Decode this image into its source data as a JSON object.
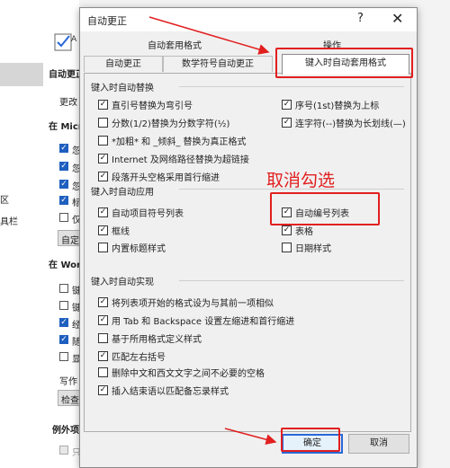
{
  "background": {
    "labels": {
      "auto_correct": "自动更正",
      "change": "更改",
      "in_ms": "在 Micr",
      "qu": "区",
      "tools": "具栏",
      "custom": "自定",
      "in_word": "在 Wor",
      "write": "写作",
      "check": "检查",
      "exceptions": "例外项",
      "item": "只"
    },
    "checkbox_labels": [
      "忽",
      "忽",
      "忽",
      "标",
      "仅",
      "键",
      "键",
      "经",
      "随",
      "显"
    ]
  },
  "dialog": {
    "title": "自动更正",
    "help_label": "?",
    "close_label": "✕",
    "tabs_row1": [
      "自动套用格式",
      "操作"
    ],
    "tabs_row2": [
      "自动更正",
      "数学符号自动更正",
      "键入时自动套用格式"
    ],
    "groups": [
      {
        "title": "键入时自动替换",
        "options": [
          {
            "label": "直引号替换为弯引号",
            "checked": true
          },
          {
            "label": "序号(1st)替换为上标",
            "checked": true
          },
          {
            "label": "分数(1/2)替换为分数字符(½)",
            "checked": false
          },
          {
            "label": "连字符(--)替换为长划线(—)",
            "checked": true
          },
          {
            "label": "*加粗* 和 _倾斜_ 替换为真正格式",
            "checked": false
          },
          {
            "label": "Internet 及网络路径替换为超链接",
            "checked": true
          },
          {
            "label": "段落开头空格采用首行缩进",
            "checked": true
          }
        ]
      },
      {
        "title": "键入时自动应用",
        "options": [
          {
            "label": "自动项目符号列表",
            "checked": true
          },
          {
            "label": "自动编号列表",
            "checked": true
          },
          {
            "label": "框线",
            "checked": true
          },
          {
            "label": "表格",
            "checked": true
          },
          {
            "label": "内置标题样式",
            "checked": false
          },
          {
            "label": "日期样式",
            "checked": false
          }
        ]
      },
      {
        "title": "键入时自动实现",
        "options": [
          {
            "label": "将列表项开始的格式设为与其前一项相似",
            "checked": true
          },
          {
            "label": "用 Tab 和 Backspace 设置左缩进和首行缩进",
            "checked": true
          },
          {
            "label": "基于所用格式定义样式",
            "checked": false
          },
          {
            "label": "匹配左右括号",
            "checked": true
          },
          {
            "label": "删除中文和西文文字之间不必要的空格",
            "checked": false
          },
          {
            "label": "插入结束语以匹配备忘录样式",
            "checked": true
          }
        ]
      }
    ],
    "ok_label": "确定",
    "cancel_label": "取消"
  },
  "annotation": {
    "text": "取消勾选",
    "color": "#e21f1f"
  },
  "colors": {
    "accent": "#2b68d8",
    "annotation_red": "#e21f1f"
  },
  "icons": {
    "check_mark": "✓"
  }
}
